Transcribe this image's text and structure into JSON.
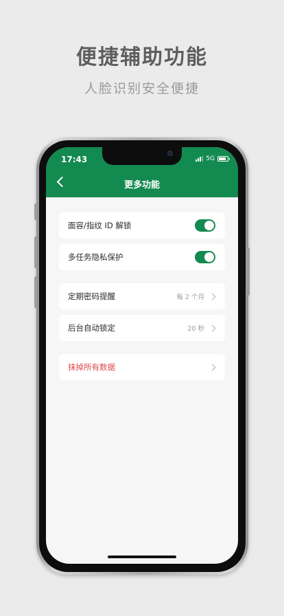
{
  "promo": {
    "headline": "便捷辅助功能",
    "subline": "人脸识别安全便捷"
  },
  "status_bar": {
    "time": "17:43",
    "network": "5G"
  },
  "nav": {
    "title": "更多功能"
  },
  "settings": {
    "face_id": {
      "label": "面容/指纹 ID 解锁",
      "enabled": true
    },
    "multitask_privacy": {
      "label": "多任务隐私保护",
      "enabled": true
    },
    "password_reminder": {
      "label": "定期密码提醒",
      "value": "每 2 个月"
    },
    "auto_lock": {
      "label": "后台自动锁定",
      "value": "20 秒"
    },
    "erase_data": {
      "label": "抹掉所有数据"
    }
  },
  "colors": {
    "accent": "#138a50",
    "danger": "#e0494a"
  }
}
